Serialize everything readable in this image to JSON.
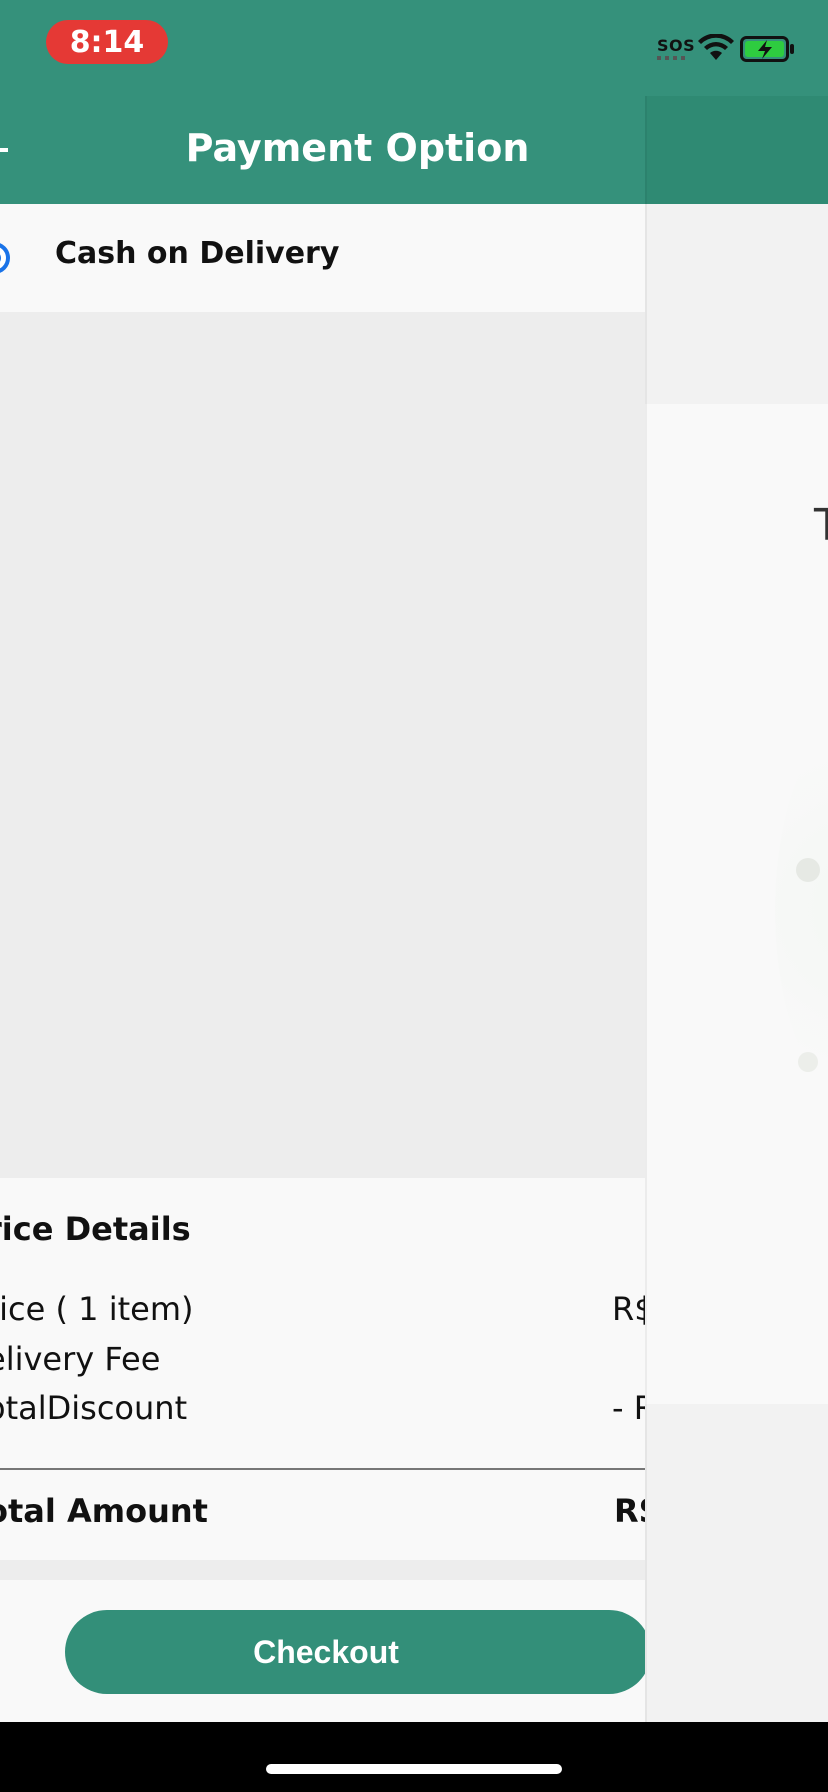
{
  "status_bar": {
    "time": "8:14",
    "sos": "SOS",
    "icons": [
      "wifi-icon",
      "battery-charging-icon"
    ],
    "colors": {
      "bar": "#35917b",
      "time_pill": "#e53935"
    }
  },
  "header": {
    "title": "Payment Option",
    "color": "#35917b"
  },
  "payment": {
    "selected_option": "Cash on Delivery",
    "radio_color": "#1a73e8"
  },
  "price_details": {
    "title": "rice Details",
    "rows": [
      {
        "label": "rice ( 1 item)",
        "value": "R$"
      },
      {
        "label": "elivery Fee",
        "value": ""
      },
      {
        "label": "otalDiscount",
        "value": "- R"
      }
    ],
    "total": {
      "label": "otal Amount",
      "value": "RS"
    }
  },
  "checkout": {
    "label": "Checkout",
    "color": "#338f79"
  },
  "side_panel": {
    "visible_text": "T"
  }
}
